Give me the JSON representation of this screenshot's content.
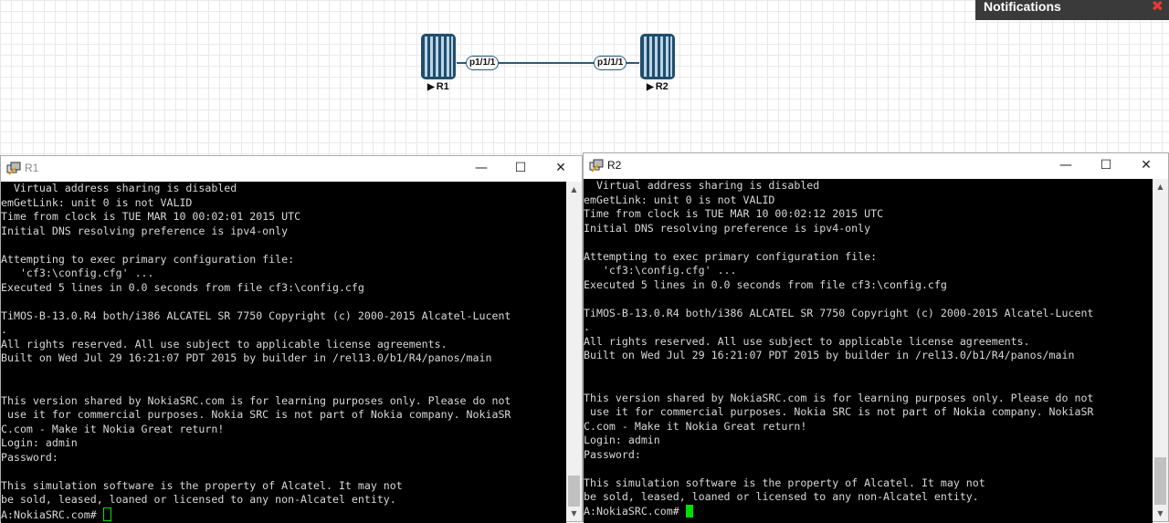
{
  "notifications": {
    "title": "Notifications",
    "close_icon": "close-icon"
  },
  "topology": {
    "routers": [
      {
        "name": "R1",
        "icon": "router-icon"
      },
      {
        "name": "R2",
        "icon": "router-icon"
      }
    ],
    "link": {
      "port_a": "p1/1/1",
      "port_b": "p1/1/1"
    },
    "colors": {
      "router": "#1f4e6e",
      "link": "#2a5a7a"
    }
  },
  "windows": [
    {
      "title": "R1",
      "lines": [
        "  Virtual address sharing is disabled",
        "emGetLink: unit 0 is not VALID",
        "Time from clock is TUE MAR 10 00:02:01 2015 UTC",
        "Initial DNS resolving preference is ipv4-only",
        "",
        "Attempting to exec primary configuration file:",
        "   'cf3:\\config.cfg' ...",
        "Executed 5 lines in 0.0 seconds from file cf3:\\config.cfg",
        "",
        "TiMOS-B-13.0.R4 both/i386 ALCATEL SR 7750 Copyright (c) 2000-2015 Alcatel-Lucent",
        ".",
        "All rights reserved. All use subject to applicable license agreements.",
        "Built on Wed Jul 29 16:21:07 PDT 2015 by builder in /rel13.0/b1/R4/panos/main",
        "",
        "",
        "This version shared by NokiaSRC.com is for learning purposes only. Please do not",
        " use it for commercial purposes. Nokia SRC is not part of Nokia company. NokiaSR",
        "C.com - Make it Nokia Great return!",
        "Login: admin",
        "Password:",
        "",
        "This simulation software is the property of Alcatel. It may not",
        "be sold, leased, loaned or licensed to any non-Alcatel entity."
      ],
      "prompt": "A:NokiaSRC.com# "
    },
    {
      "title": "R2",
      "lines": [
        "  Virtual address sharing is disabled",
        "emGetLink: unit 0 is not VALID",
        "Time from clock is TUE MAR 10 00:02:12 2015 UTC",
        "Initial DNS resolving preference is ipv4-only",
        "",
        "Attempting to exec primary configuration file:",
        "   'cf3:\\config.cfg' ...",
        "Executed 5 lines in 0.0 seconds from file cf3:\\config.cfg",
        "",
        "TiMOS-B-13.0.R4 both/i386 ALCATEL SR 7750 Copyright (c) 2000-2015 Alcatel-Lucent",
        ".",
        "All rights reserved. All use subject to applicable license agreements.",
        "Built on Wed Jul 29 16:21:07 PDT 2015 by builder in /rel13.0/b1/R4/panos/main",
        "",
        "",
        "This version shared by NokiaSRC.com is for learning purposes only. Please do not",
        " use it for commercial purposes. Nokia SRC is not part of Nokia company. NokiaSR",
        "C.com - Make it Nokia Great return!",
        "Login: admin",
        "Password:",
        "",
        "This simulation software is the property of Alcatel. It may not",
        "be sold, leased, loaned or licensed to any non-Alcatel entity."
      ],
      "prompt": "A:NokiaSRC.com# "
    }
  ],
  "controls": {
    "minimize": "—",
    "maximize": "☐",
    "close": "✕"
  },
  "terminal_colors": {
    "background": "#000000",
    "text": "#d8d8d8",
    "cursor": "#00e000"
  }
}
